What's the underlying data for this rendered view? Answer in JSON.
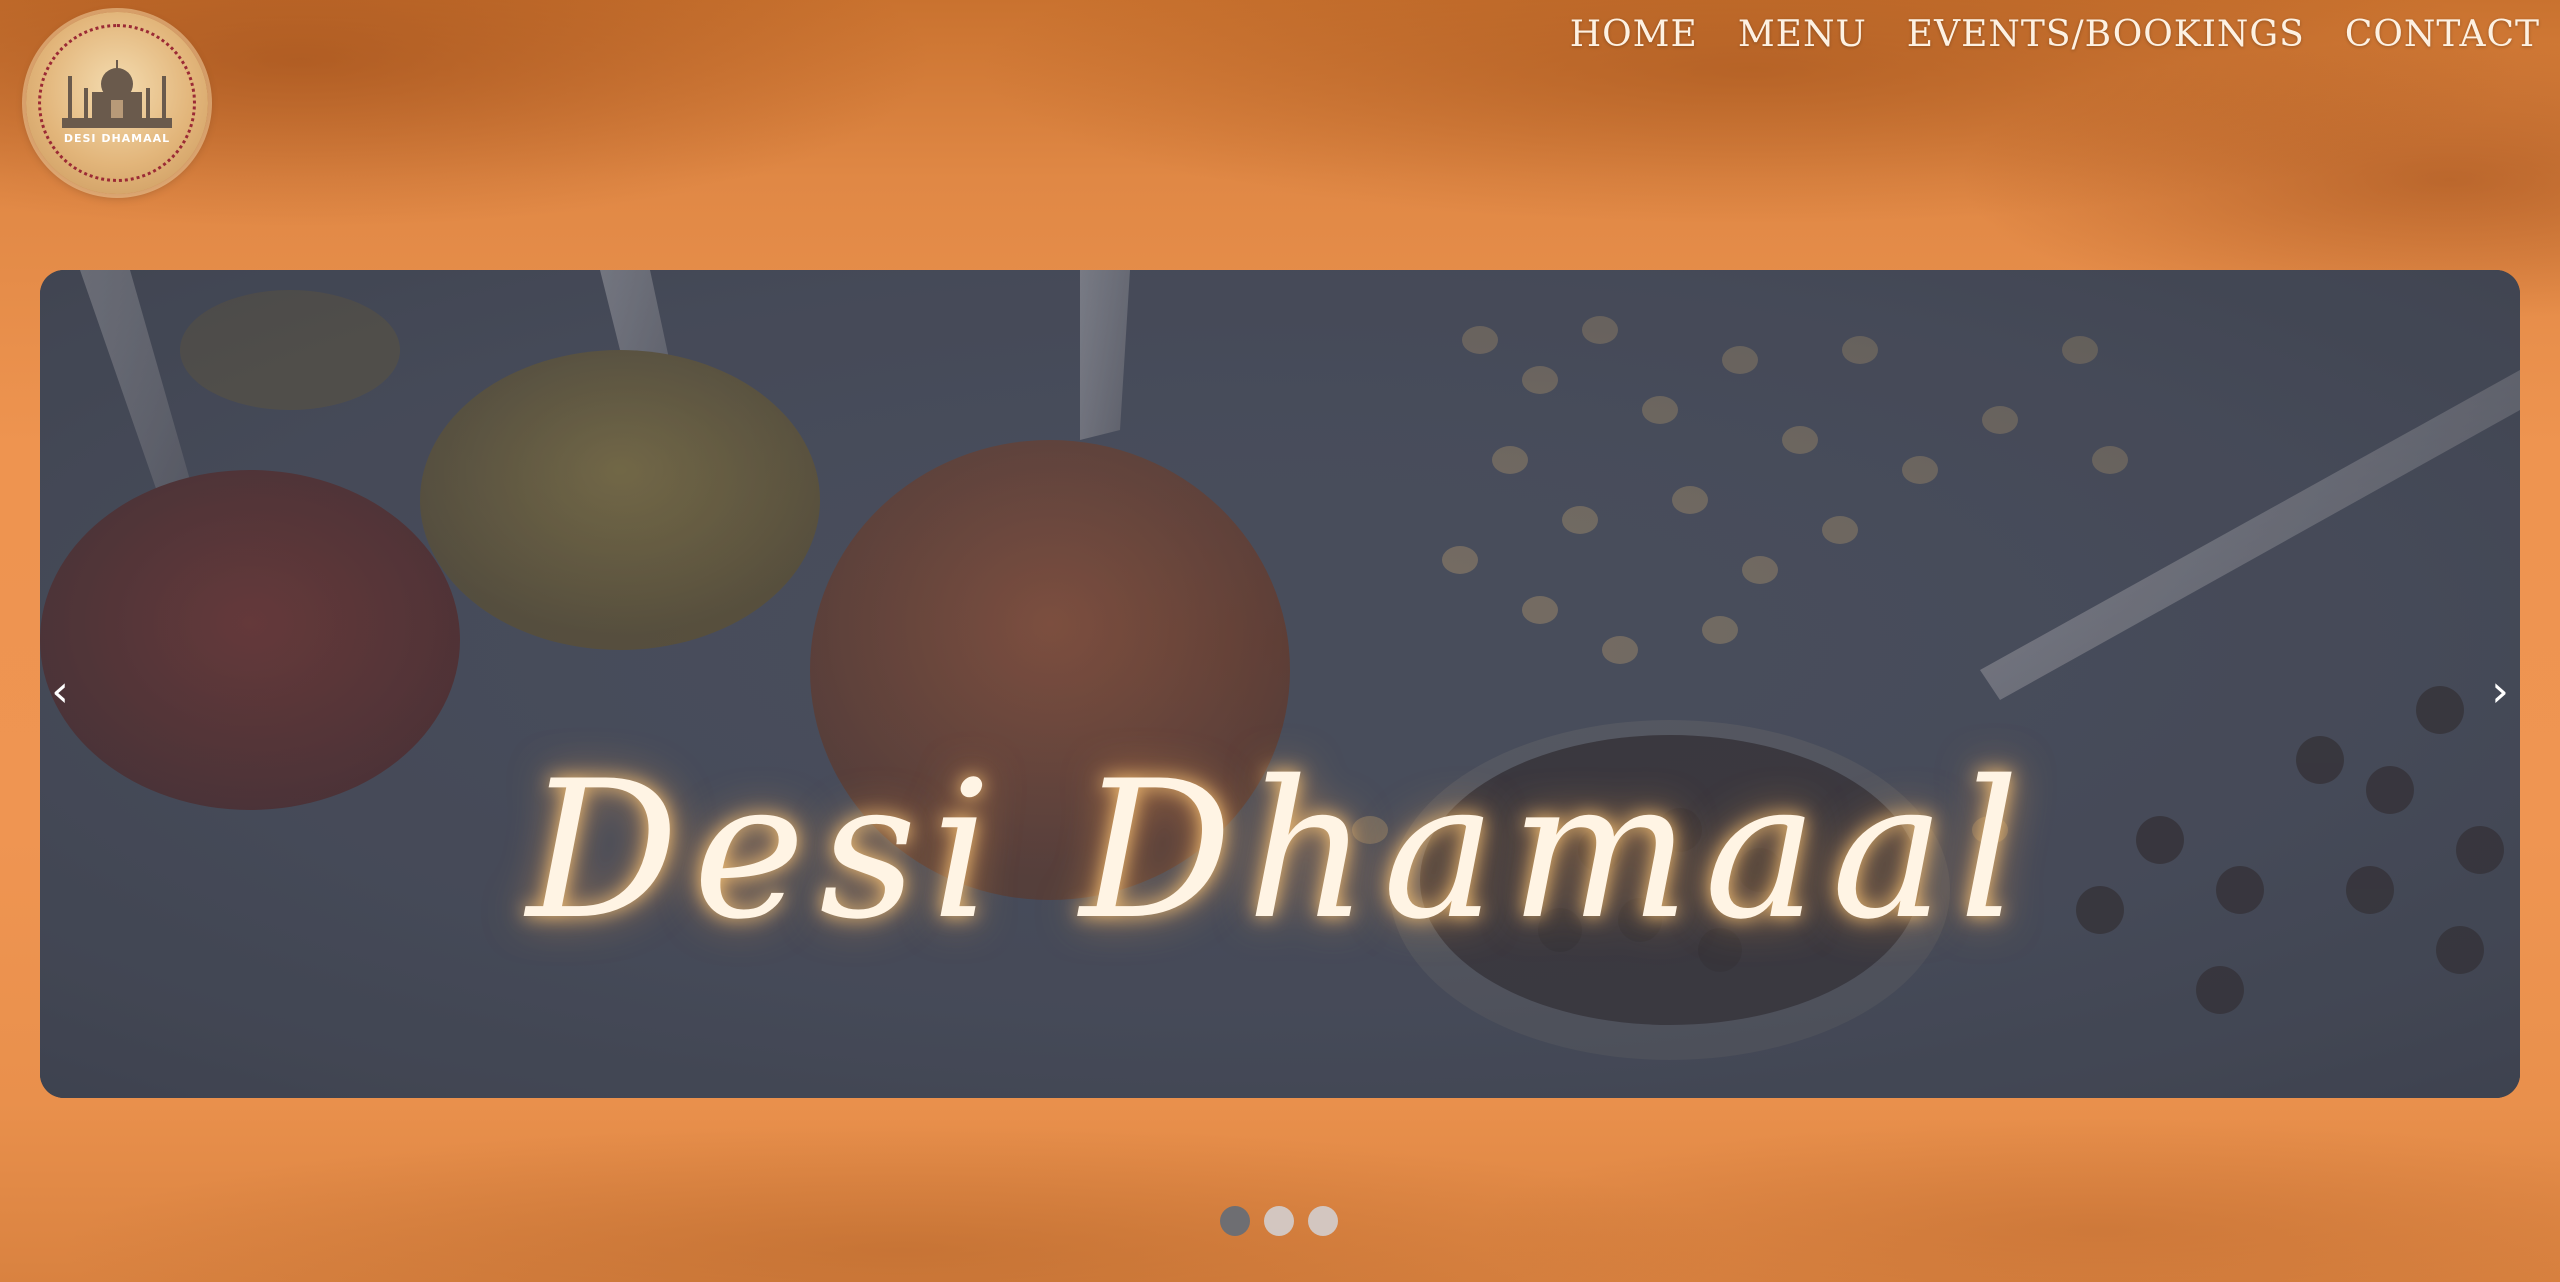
{
  "logo": {
    "text": "DESI DHAMAAL",
    "icon": "taj-mahal-icon"
  },
  "nav": {
    "items": [
      {
        "label": "HOME"
      },
      {
        "label": "MENU"
      },
      {
        "label": "EVENTS/BOOKINGS"
      },
      {
        "label": "CONTACT"
      }
    ]
  },
  "hero": {
    "title": "Desi Dhamaal",
    "prev_icon": "‹",
    "next_icon": "›",
    "slide_count": 3,
    "active_slide": 1
  },
  "colors": {
    "background": "#ee9450",
    "nav_text": "#fdf1e2",
    "title_glow": "#ffc878",
    "slide_bg": "#3d4251"
  }
}
